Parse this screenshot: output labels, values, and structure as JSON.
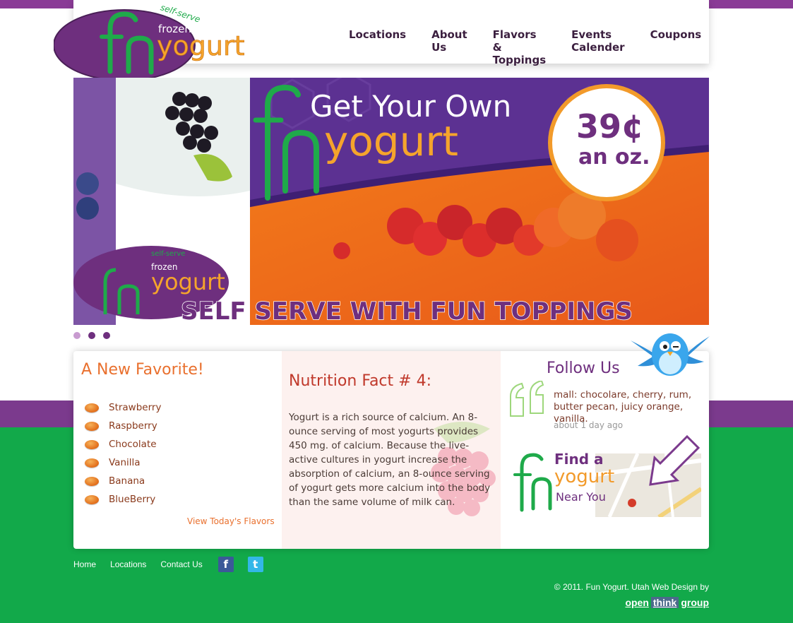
{
  "logo": {
    "tagline": "self-serve",
    "small": "frozen",
    "mark": "fn",
    "word": "yogurt"
  },
  "nav": [
    {
      "label": "Locations"
    },
    {
      "label": "About Us"
    },
    {
      "label": "Flavors & Toppings"
    },
    {
      "label": "Events Calender"
    },
    {
      "label": "Coupons"
    }
  ],
  "banner": {
    "headline1": "Get Your Own",
    "headline2": "yogurt",
    "price": "39¢",
    "price_unit": "an oz.",
    "footer": "SELF SERVE WITH FUN TOPPINGS",
    "cup_logo_small": "frozen",
    "cup_logo_word": "yogurt",
    "cup_logo_tag": "self-serve",
    "dots_total": 3,
    "dots_active": 1
  },
  "favorites": {
    "title": "A New Favorite!",
    "items": [
      "Strawberry",
      "Raspberry",
      "Chocolate",
      "Vanilla",
      "Banana",
      "BlueBerry"
    ],
    "link": "View Today's Flavors"
  },
  "nutrition": {
    "title": "Nutrition Fact # 4:",
    "text": "Yogurt is a rich source of calcium. An 8-ounce serving of most yogurts provides 450 mg. of calcium. Because the live-active cultures in yogurt increase the absorption of calcium, an 8-ounce serving of yogurt gets more calcium into the body than the same volume of milk can."
  },
  "follow": {
    "title": "Follow Us",
    "tweet": "mall: chocolare, cherry, rum, butter pecan, juicy orange, vanilla.",
    "time": "about 1 day ago"
  },
  "find": {
    "line1": "Find a",
    "line2": "yogurt",
    "line3": "Near You",
    "mark": "fn"
  },
  "footer": {
    "links": [
      "Home",
      "Locations",
      "Contact Us"
    ],
    "copyright": "© 2011. Fun Yogurt. Utah Web Design by",
    "brand_open": "open",
    "brand_think": "think",
    "brand_group": "group"
  },
  "colors": {
    "purple": "#7b3a8d",
    "green": "#12a94a",
    "orange": "#e9702e"
  }
}
